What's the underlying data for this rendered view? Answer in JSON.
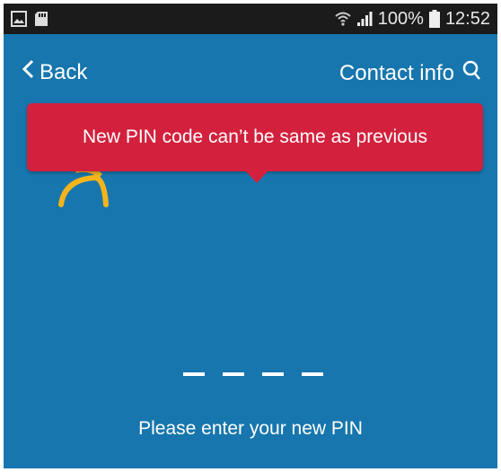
{
  "status_bar": {
    "battery_percent": "100%",
    "time": "12:52",
    "icons": [
      "image-icon",
      "sd-card-icon",
      "wifi-icon",
      "signal-icon",
      "battery-icon"
    ]
  },
  "header": {
    "back_label": "Back",
    "contact_label": "Contact info",
    "contact_icon": "search-icon",
    "logo_icon": "brand-logo-icon"
  },
  "tooltip": {
    "message": "New PIN code can’t be same as previous",
    "color": "#d3213d"
  },
  "pin": {
    "length": 4,
    "prompt": "Please enter your new PIN"
  },
  "colors": {
    "background": "#1776ad",
    "status_bar": "#1b1b1b",
    "accent": "#f5b41b"
  }
}
